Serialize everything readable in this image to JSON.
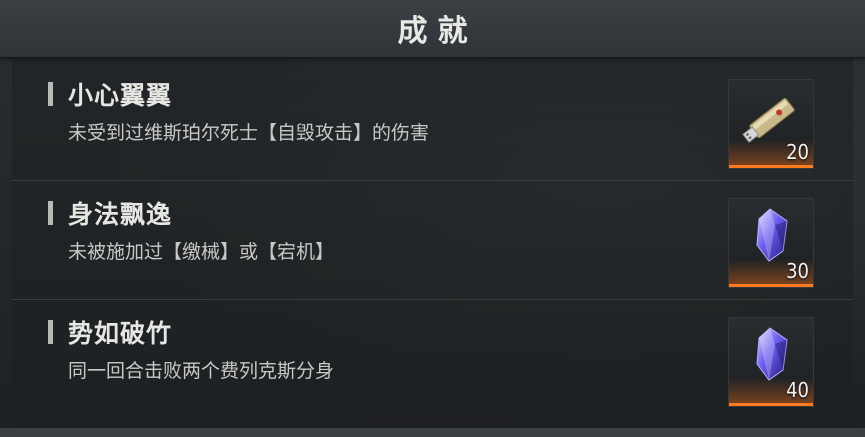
{
  "header": {
    "title": "成就"
  },
  "achievements": [
    {
      "title": "小心翼翼",
      "description": "未受到过维斯珀尔死士【自毁攻击】的伤害",
      "reward": {
        "icon": "usb-drive-icon",
        "count": "20"
      }
    },
    {
      "title": "身法飘逸",
      "description": "未被施加过【缴械】或【宕机】",
      "reward": {
        "icon": "purple-crystal-icon",
        "count": "30"
      }
    },
    {
      "title": "势如破竹",
      "description": "同一回合击败两个费列克斯分身",
      "reward": {
        "icon": "purple-crystal-icon",
        "count": "40"
      }
    }
  ],
  "colors": {
    "accent": "#ff7a1e",
    "header_bg": "#3b4045",
    "panel_bg": "#1f2224",
    "title_text": "#e8e8e6",
    "desc_text": "#c8c8c5"
  }
}
